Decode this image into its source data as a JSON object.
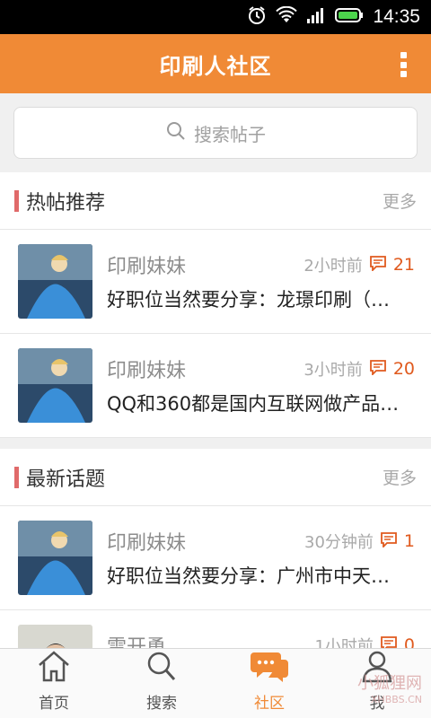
{
  "status": {
    "time": "14:35"
  },
  "header": {
    "title": "印刷人社区"
  },
  "search": {
    "placeholder": "搜索帖子"
  },
  "hot": {
    "title": "热帖推荐",
    "more": "更多",
    "posts": [
      {
        "author": "印刷妹妹",
        "time": "2小时前",
        "count": "21",
        "title": "好职位当然要分享：龙璟印刷（…"
      },
      {
        "author": "印刷妹妹",
        "time": "3小时前",
        "count": "20",
        "title": "QQ和360都是国内互联网做产品…"
      }
    ]
  },
  "latest": {
    "title": "最新话题",
    "more": "更多",
    "posts": [
      {
        "author": "印刷妹妹",
        "time": "30分钟前",
        "count": "1",
        "title": "好职位当然要分享：广州市中天…"
      },
      {
        "author": "雷开勇",
        "time": "1小时前",
        "count": "0",
        "title": ""
      }
    ]
  },
  "tabs": [
    {
      "label": "首页",
      "icon": "home-icon"
    },
    {
      "label": "搜索",
      "icon": "search-icon"
    },
    {
      "label": "社区",
      "icon": "community-icon",
      "active": true
    },
    {
      "label": "我",
      "icon": "user-icon"
    }
  ],
  "watermark": {
    "text": "小狐狸网",
    "sub": "XHBBS.CN"
  },
  "colors": {
    "accent": "#f08a36",
    "section_bar": "#e06a6a",
    "count": "#e05a1e"
  }
}
